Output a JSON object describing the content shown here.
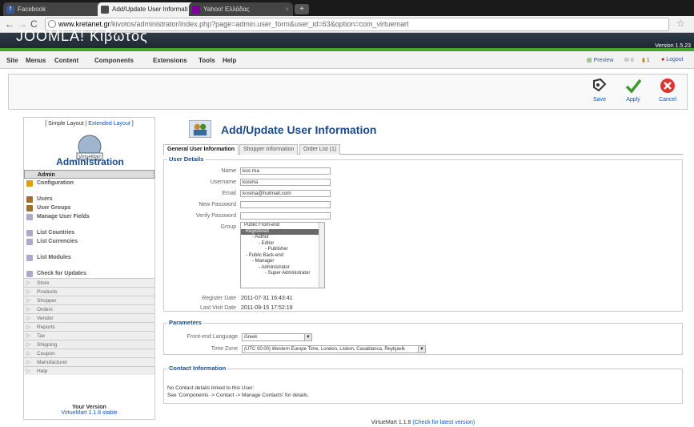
{
  "browser": {
    "tabs": [
      {
        "label": "Facebook",
        "favicon": "f"
      },
      {
        "label": "Add/Update User Informati",
        "favicon": "VM"
      },
      {
        "label": "Yahoo! Ελλάδας",
        "favicon": "Y!"
      }
    ],
    "new_tab": "+",
    "url_domain": "www.kretanet.gr",
    "url_path": "/kivotos/administrator/index.php?page=admin.user_form&user_id=63&option=com_virtuemart"
  },
  "joomla": {
    "site_title": "JOOMLA! Κιβωτος",
    "version": "Version 1.5.23",
    "menu": [
      "Site",
      "Menus",
      "Content",
      "Components",
      "Extensions",
      "Tools",
      "Help"
    ],
    "right_links": [
      "Preview",
      "0",
      "1",
      "Logout"
    ]
  },
  "toolbar": {
    "save": "Save",
    "apply": "Apply",
    "cancel": "Cancel"
  },
  "sidebar": {
    "layout_simple": "[ Simple Layout |",
    "layout_extended": "Extended Layout",
    "layout_close": "]",
    "logo_text": "VirtueMart",
    "title": "Administration",
    "items": [
      {
        "label": "Admin",
        "kind": "head",
        "icon": ""
      },
      {
        "label": "Configuration",
        "kind": "bold",
        "icon": "#d9a400"
      },
      {
        "label": "Users",
        "kind": "bold",
        "icon": "#a07030"
      },
      {
        "label": "User Groups",
        "kind": "bold",
        "icon": "#a07030"
      },
      {
        "label": "Manage User Fields",
        "kind": "bold",
        "icon": "#aac"
      },
      {
        "label": "List Countries",
        "kind": "bold",
        "icon": "#aac"
      },
      {
        "label": "List Currencies",
        "kind": "bold",
        "icon": "#aac"
      },
      {
        "label": "List Modules",
        "kind": "bold",
        "icon": "#aac"
      },
      {
        "label": "Check for Updates",
        "kind": "bold",
        "icon": "#aac"
      },
      {
        "label": "Store",
        "kind": "cat"
      },
      {
        "label": "Products",
        "kind": "cat"
      },
      {
        "label": "Shopper",
        "kind": "cat"
      },
      {
        "label": "Orders",
        "kind": "cat"
      },
      {
        "label": "Vendor",
        "kind": "cat"
      },
      {
        "label": "Reports",
        "kind": "cat"
      },
      {
        "label": "Tax",
        "kind": "cat"
      },
      {
        "label": "Shipping",
        "kind": "cat"
      },
      {
        "label": "Coupon",
        "kind": "cat"
      },
      {
        "label": "Manufacturer",
        "kind": "cat"
      },
      {
        "label": "Help",
        "kind": "cat"
      }
    ],
    "your_version_label": "Your Version",
    "your_version_value": "VirtueMart 1.1.8 stable"
  },
  "main": {
    "title": "Add/Update User Information",
    "tabs": [
      "General User Information",
      "Shopper Information",
      "Order List (1)"
    ],
    "user_details": {
      "legend": "User Details",
      "name_label": "Name",
      "name_value": "kos ma",
      "username_label": "Username",
      "username_value": "kosma",
      "email_label": "Email",
      "email_value": "kosma@hotmail.com",
      "new_password_label": "New Password",
      "verify_password_label": "Verify Password",
      "group_label": "Group",
      "groups": [
        {
          "label": "Public Front-end",
          "sel": false
        },
        {
          "label": "- Registered",
          "sel": true
        },
        {
          "label": "- Author",
          "sel": false
        },
        {
          "label": "- Editor",
          "sel": false
        },
        {
          "label": "- Publisher",
          "sel": false
        },
        {
          "label": "- Public Back-end",
          "sel": false
        },
        {
          "label": "- Manager",
          "sel": false
        },
        {
          "label": "- Administrator",
          "sel": false
        },
        {
          "label": "- Super Administrator",
          "sel": false
        }
      ],
      "register_label": "Register Date",
      "register_value": "2011-07-31 16:43:41",
      "lastvisit_label": "Last Visit Date",
      "lastvisit_value": "2011-09-15 17:52:19"
    },
    "parameters": {
      "legend": "Parameters",
      "lang_label": "Front-end Language",
      "lang_value": "Greek",
      "tz_label": "Time Zone",
      "tz_value": "(UTC 00:00) Western Europe Time, London, Lisbon, Casablanca, Reykjavik"
    },
    "contact": {
      "legend": "Contact Information",
      "line1": "No Contact details linked to this User:",
      "line2": "See 'Components -> Contact -> Manage Contacts' for details."
    },
    "footer_text": "VirtueMart 1.1.8",
    "footer_link": "(Check for latest version)"
  }
}
